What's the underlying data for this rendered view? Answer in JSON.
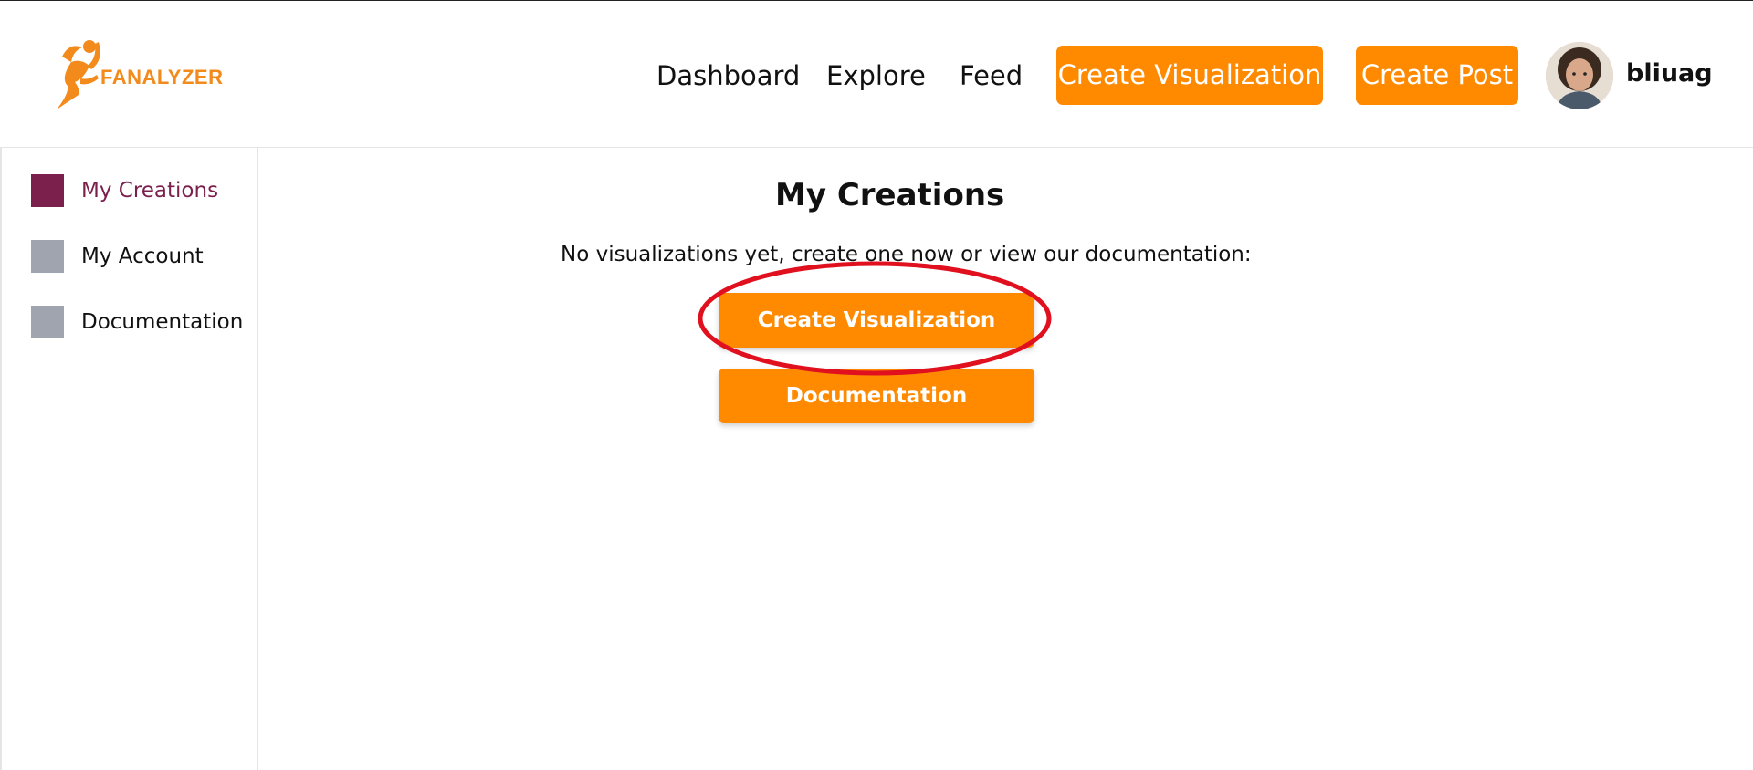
{
  "header": {
    "logo_text": "FANALYZER",
    "nav": {
      "dashboard": "Dashboard",
      "explore": "Explore",
      "feed": "Feed"
    },
    "create_visualization_label": "Create Visualization",
    "create_post_label": "Create Post",
    "username": "bliuag"
  },
  "sidebar": {
    "items": [
      {
        "label": "My Creations",
        "active": true,
        "color": "#7b1f4d"
      },
      {
        "label": "My Account",
        "active": false,
        "color": "#a0a4ae"
      },
      {
        "label": "Documentation",
        "active": false,
        "color": "#a0a4ae"
      }
    ]
  },
  "main": {
    "title": "My Creations",
    "empty_message": "No visualizations yet, create one now or view our documentation:",
    "create_visualization_label": "Create Visualization",
    "documentation_label": "Documentation"
  },
  "colors": {
    "accent": "#ff8a00",
    "active_nav": "#7b1f4d",
    "inactive_nav": "#a0a4ae",
    "annotation": "#e0101e"
  }
}
